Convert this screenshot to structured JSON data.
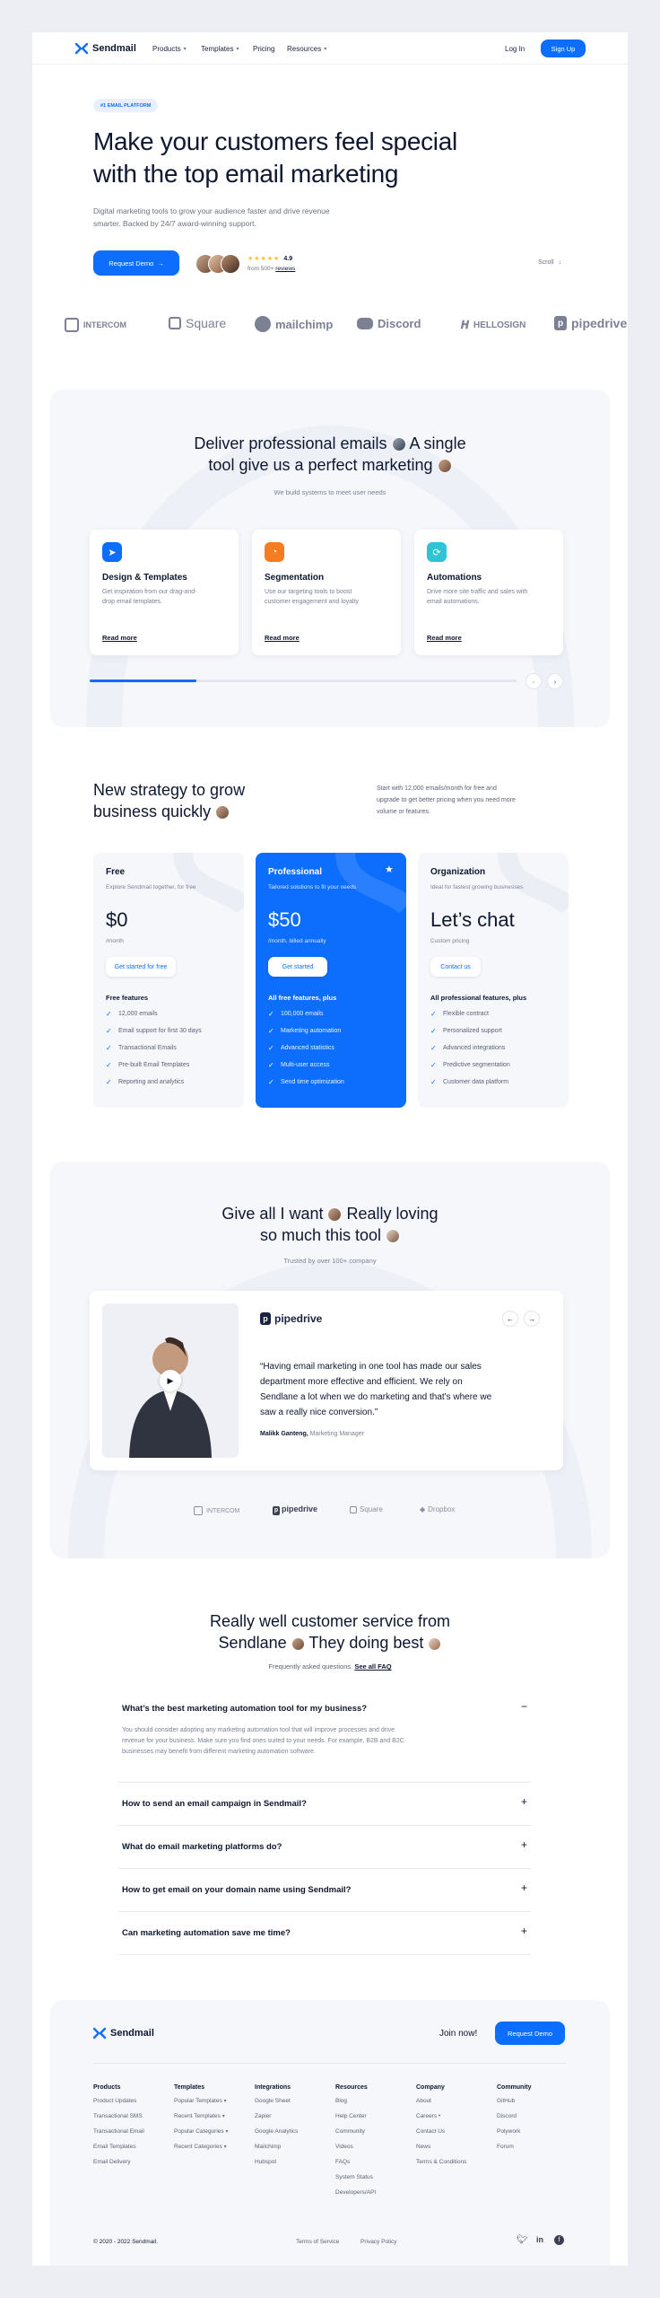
{
  "nav": {
    "brand": "Sendmail",
    "links": [
      "Products",
      "Templates",
      "Pricing",
      "Resources"
    ],
    "login": "Log In",
    "signup": "Sign Up"
  },
  "hero": {
    "badge": "#1 EMAIL PLATFORM",
    "title_line1": "Make your customers feel special",
    "title_line2": "with the top email marketing",
    "subtitle_line1": "Digital marketing tools to grow your audience faster and drive revenue",
    "subtitle_line2": "smarter. Backed by 24/7 award-winning support.",
    "cta": "Request Demo",
    "rating": "4.9",
    "reviews_prefix": "from 500+",
    "reviews_link": "reviews",
    "scroll": "Scroll",
    "stars": 5
  },
  "logos": [
    "INTERCOM",
    "Square",
    "mailchimp",
    "Discord",
    "HELLOSIGN",
    "pipedrive"
  ],
  "features": {
    "title_line1_a": "Deliver professional emails",
    "title_line1_b": "A single",
    "title_line2": "tool give us a perfect marketing",
    "subtitle": "We build systems to meet user needs",
    "cards": [
      {
        "title": "Design & Templates",
        "desc_line1": "Get inspiration from our drag-and-",
        "desc_line2": "drop email templates.",
        "link": "Read more",
        "color": "#0d6efd"
      },
      {
        "title": "Segmentation",
        "desc_line1": "Use our targeting tools to boost",
        "desc_line2": "customer engagement and loyalty",
        "link": "Read more",
        "color": "#f57c1f"
      },
      {
        "title": "Automations",
        "desc_line1": "Drive more site traffic and sales with",
        "desc_line2": "email automations.",
        "link": "Read more",
        "color": "#2ec4d6"
      }
    ],
    "progress": 0.25
  },
  "pricing": {
    "title_line1": "New strategy to grow",
    "title_line2": "business quickly",
    "side_line1": "Start with 12,000 emails/month for free and",
    "side_line2": "upgrade to get better pricing when you need more",
    "side_line3": "volume or features.",
    "plans": [
      {
        "name": "Free",
        "tagline": "Explore Sendmail together, for free",
        "price": "$0",
        "period": "/month",
        "cta": "Get started for free",
        "features_title": "Free features",
        "features": [
          "12,000 emails",
          "Email support for first 30 days",
          "Transactional Emails",
          "Pre-built Email Templates",
          "Reporting and analytics"
        ]
      },
      {
        "name": "Professional",
        "tagline": "Tailored solutions to fit your needs",
        "price": "$50",
        "period": "/month, billed annually",
        "cta": "Get started",
        "features_title": "All free features, plus",
        "features": [
          "100,000 emails",
          "Marketing automation",
          "Advanced statistics",
          "Multi-user access",
          "Send time optimization"
        ]
      },
      {
        "name": "Organization",
        "tagline": "Ideal for fastest growing businesses",
        "price": "Let’s chat",
        "period": "Custom pricing",
        "cta": "Contact us",
        "features_title": "All professional features, plus",
        "features": [
          "Flexible contract",
          "Personalized support",
          "Advanced integrations",
          "Predictive segmentation",
          "Customer data platform"
        ]
      }
    ]
  },
  "testimonial": {
    "title_line1_a": "Give all I want",
    "title_line1_b": "Really loving",
    "title_line2": "so much this tool",
    "subtitle": "Trusted by over 100+ company",
    "company": "pipedrive",
    "quote_line1": "“Having email marketing in one tool has made our sales",
    "quote_line2": "department more effective and efficient. We rely on",
    "quote_line3": "Sendlane a lot when we do marketing and that's where we",
    "quote_line4": "saw a really nice conversion.”",
    "author": "Malikk Ganteng,",
    "role": "Marketing Manager",
    "logos": [
      "INTERCOM",
      "pipedrive",
      "Square",
      "Dropbox"
    ]
  },
  "faq": {
    "title_line1": "Really well customer service from",
    "title_line2_a": "Sendlane",
    "title_line2_b": "They doing best",
    "subtitle": "Frequently asked questions.",
    "see_all": "See all FAQ",
    "items": [
      {
        "q": "What’s the best marketing automation tool for my business?",
        "sign": "−"
      },
      {
        "q": "How to send an email campaign in Sendmail?",
        "sign": "+"
      },
      {
        "q": "What do email marketing platforms do?",
        "sign": "+"
      },
      {
        "q": "How to get email on your domain name using Sendmail?",
        "sign": "+"
      },
      {
        "q": "Can marketing automation save me time?",
        "sign": "+"
      }
    ],
    "answer_line1": "You should consider adopting any marketing automation tool that will improve processes and drive",
    "answer_line2": "revenue for your business. Make sure you find ones suited to your needs. For example, B2B and B2C",
    "answer_line3": "businesses may benefit from different marketing automation software."
  },
  "footer": {
    "brand": "Sendmail",
    "join": "Join now!",
    "cta": "Request Demo",
    "columns": [
      {
        "title": "Products",
        "links": [
          "Product Updates",
          "Transactional SMS",
          "Transactional Email",
          "Email Templates",
          "Email Delivery"
        ]
      },
      {
        "title": "Templates",
        "links": [
          "Popular Templates",
          "Recent Templates",
          "Popular Categories",
          "Recent Categories"
        ]
      },
      {
        "title": "Integrations",
        "links": [
          "Google Sheet",
          "Zapier",
          "Google Analytics",
          "Mailchimp",
          "Hubspot"
        ]
      },
      {
        "title": "Resources",
        "links": [
          "Blog",
          "Help Center",
          "Community",
          "Videos",
          "FAQs",
          "System Status",
          "Developers/API"
        ]
      },
      {
        "title": "Company",
        "links": [
          "About",
          "Careers",
          "Contact Us",
          "News",
          "Terms & Conditions"
        ]
      },
      {
        "title": "Community",
        "links": [
          "GitHub",
          "Discord",
          "Polywork",
          "Forum"
        ]
      }
    ],
    "copyright": "© 2020 - 2022 Sendmail.",
    "terms": "Terms of Service",
    "privacy": "Privacy Policy"
  }
}
